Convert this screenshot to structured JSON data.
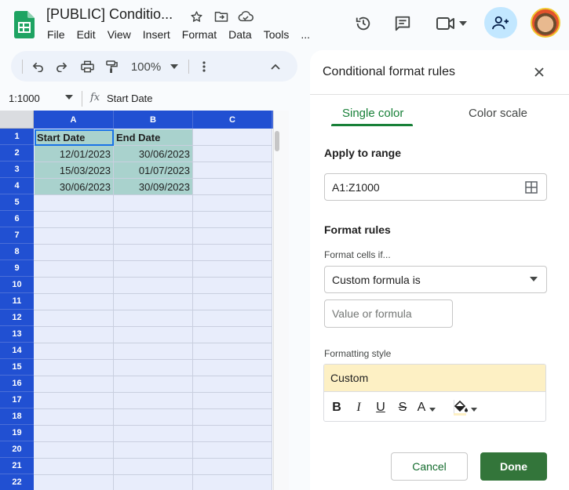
{
  "app": {
    "title": "[PUBLIC] Conditio...",
    "menu": [
      "File",
      "Edit",
      "View",
      "Insert",
      "Format",
      "Data",
      "Tools",
      "..."
    ]
  },
  "toolbar": {
    "zoom": "100%"
  },
  "formula_bar": {
    "name_box": "1:1000",
    "fx": "fx",
    "formula": "Start Date"
  },
  "grid": {
    "columns": [
      "A",
      "B",
      "C"
    ],
    "rows": [
      "1",
      "2",
      "3",
      "4",
      "5",
      "6",
      "7",
      "8",
      "9",
      "10",
      "11",
      "12",
      "13",
      "14",
      "15",
      "16",
      "17",
      "18",
      "19",
      "20",
      "21",
      "22"
    ],
    "cells": [
      [
        "Start Date",
        "End Date"
      ],
      [
        "12/01/2023",
        "30/06/2023"
      ],
      [
        "15/03/2023",
        "01/07/2023"
      ],
      [
        "30/06/2023",
        "30/09/2023"
      ]
    ]
  },
  "panel": {
    "title": "Conditional format rules",
    "tabs": [
      "Single color",
      "Color scale"
    ],
    "apply_to_range_label": "Apply to range",
    "range": "A1:Z1000",
    "format_rules_label": "Format rules",
    "format_cells_if_label": "Format cells if...",
    "condition": "Custom formula is",
    "value_placeholder": "Value or formula",
    "formatting_style_label": "Formatting style",
    "style_preview": "Custom",
    "style_buttons": [
      "B",
      "I",
      "U",
      "S",
      "A"
    ],
    "cancel": "Cancel",
    "done": "Done"
  },
  "colors": {
    "header_blue": "#2150d2",
    "cell_fill": "#a9d2cd",
    "empty_cell": "#e8edfb",
    "accent_green": "#188038",
    "done_green": "#33753a",
    "style_preview": "#fdf0c4"
  }
}
